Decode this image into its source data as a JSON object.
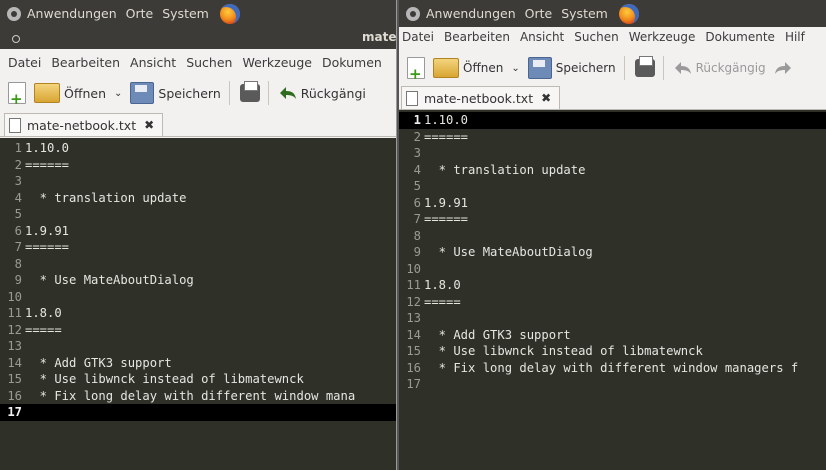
{
  "panel": {
    "menus": [
      "Anwendungen",
      "Orte",
      "System"
    ]
  },
  "window_left": {
    "title": "mate",
    "menu": [
      "Datei",
      "Bearbeiten",
      "Ansicht",
      "Suchen",
      "Werkzeuge",
      "Dokumen"
    ],
    "toolbar": {
      "open": "Öffnen",
      "save": "Speichern",
      "undo": "Rückgängi"
    },
    "tab": "mate-netbook.txt",
    "lines": [
      {
        "n": "1",
        "t": "1.10.0"
      },
      {
        "n": "2",
        "t": "======"
      },
      {
        "n": "3",
        "t": ""
      },
      {
        "n": "4",
        "t": "  * translation update"
      },
      {
        "n": "5",
        "t": ""
      },
      {
        "n": "6",
        "t": "1.9.91"
      },
      {
        "n": "7",
        "t": "======"
      },
      {
        "n": "8",
        "t": ""
      },
      {
        "n": "9",
        "t": "  * Use MateAboutDialog"
      },
      {
        "n": "10",
        "t": ""
      },
      {
        "n": "11",
        "t": "1.8.0"
      },
      {
        "n": "12",
        "t": "====="
      },
      {
        "n": "13",
        "t": ""
      },
      {
        "n": "14",
        "t": "  * Add GTK3 support"
      },
      {
        "n": "15",
        "t": "  * Use libwnck instead of libmatewnck"
      },
      {
        "n": "16",
        "t": "  * Fix long delay with different window mana"
      },
      {
        "n": "17",
        "t": ""
      }
    ],
    "current_line": "17"
  },
  "window_right": {
    "menu": [
      "Datei",
      "Bearbeiten",
      "Ansicht",
      "Suchen",
      "Werkzeuge",
      "Dokumente",
      "Hilf"
    ],
    "toolbar": {
      "open": "Öffnen",
      "save": "Speichern",
      "undo": "Rückgängig"
    },
    "tab": "mate-netbook.txt",
    "lines": [
      {
        "n": "1",
        "t": "1.10.0"
      },
      {
        "n": "2",
        "t": "======"
      },
      {
        "n": "3",
        "t": ""
      },
      {
        "n": "4",
        "t": "  * translation update"
      },
      {
        "n": "5",
        "t": ""
      },
      {
        "n": "6",
        "t": "1.9.91"
      },
      {
        "n": "7",
        "t": "======"
      },
      {
        "n": "8",
        "t": ""
      },
      {
        "n": "9",
        "t": "  * Use MateAboutDialog"
      },
      {
        "n": "10",
        "t": ""
      },
      {
        "n": "11",
        "t": "1.8.0"
      },
      {
        "n": "12",
        "t": "====="
      },
      {
        "n": "13",
        "t": ""
      },
      {
        "n": "14",
        "t": "  * Add GTK3 support"
      },
      {
        "n": "15",
        "t": "  * Use libwnck instead of libmatewnck"
      },
      {
        "n": "16",
        "t": "  * Fix long delay with different window managers f"
      },
      {
        "n": "17",
        "t": ""
      }
    ],
    "current_line": "1"
  },
  "colors": {
    "panel_bg": "#3c3b37",
    "editor_bg": "#2f3129",
    "current_line": "#000000"
  }
}
